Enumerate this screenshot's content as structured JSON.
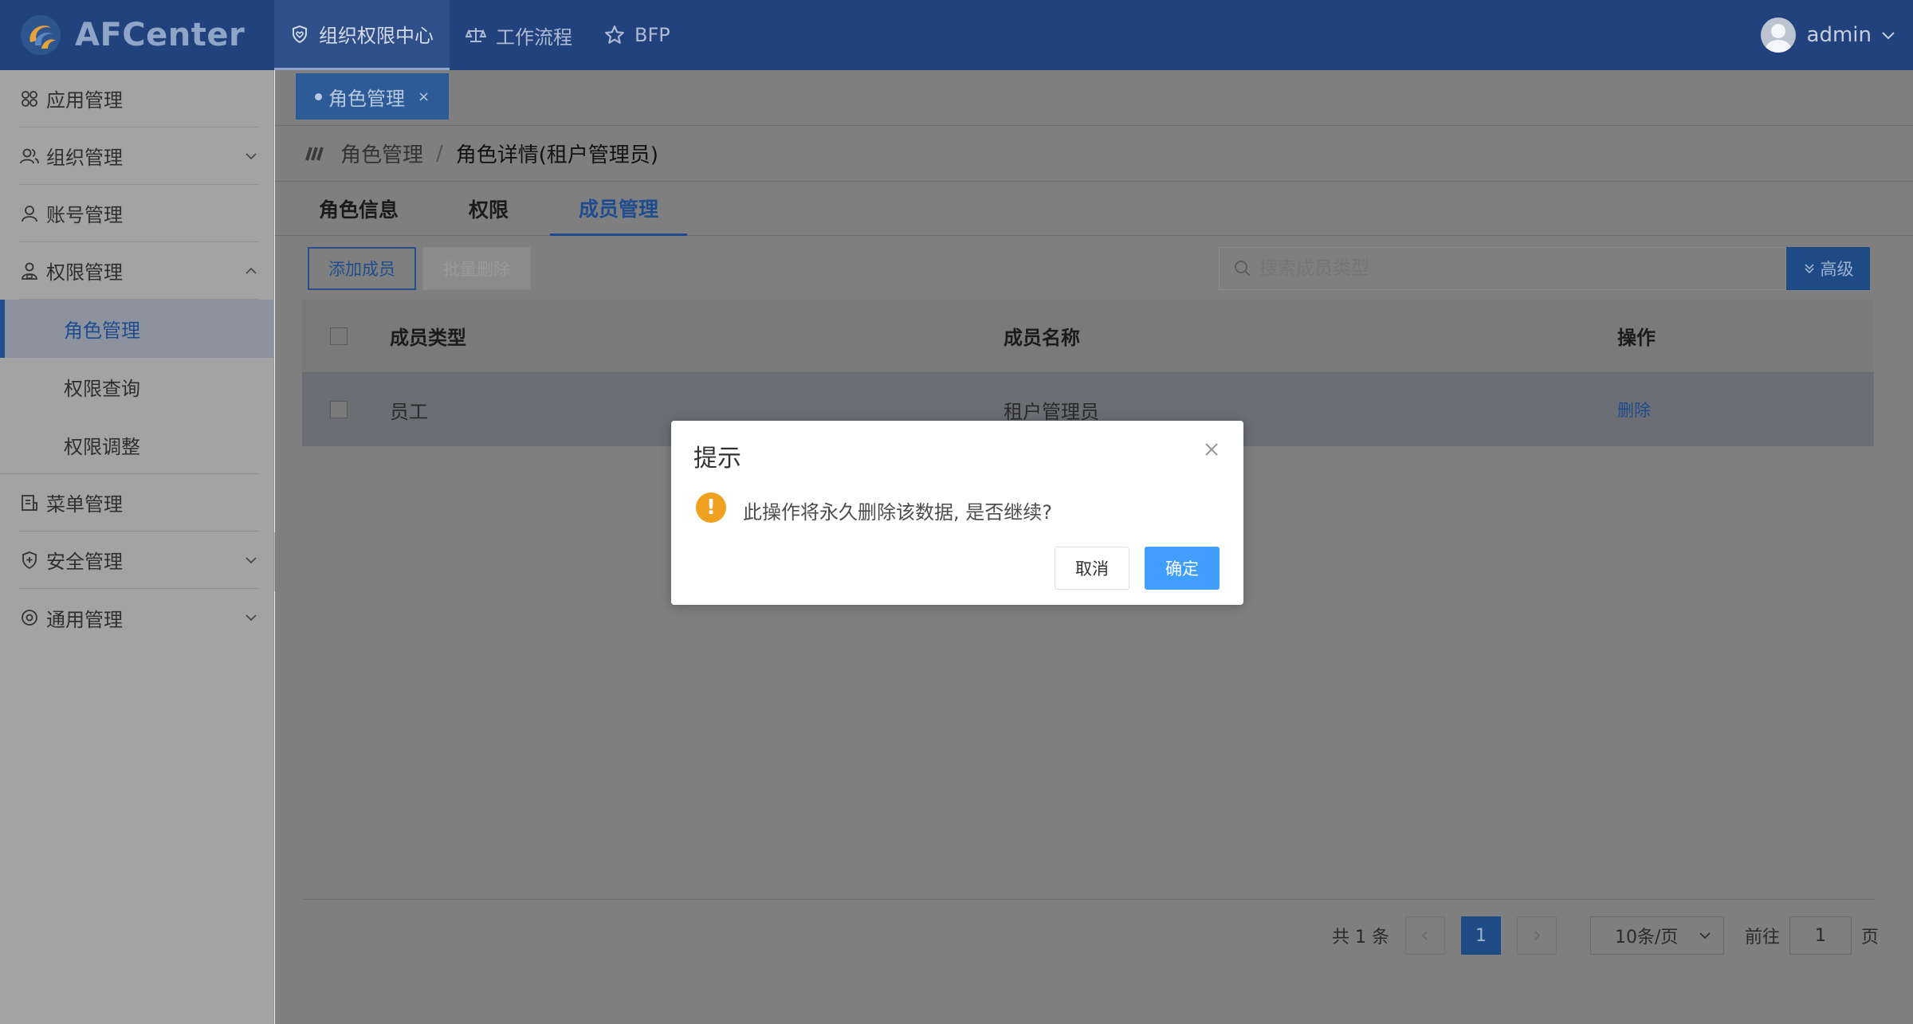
{
  "app": {
    "name": "AFCenter"
  },
  "topnav": {
    "items": [
      {
        "label": "组织权限中心",
        "icon": "shield-heart-icon",
        "active": true
      },
      {
        "label": "工作流程",
        "icon": "scale-icon",
        "active": false
      },
      {
        "label": "BFP",
        "icon": "star-icon",
        "active": false
      }
    ]
  },
  "user": {
    "name": "admin"
  },
  "sidebar": {
    "items": [
      {
        "label": "应用管理",
        "icon": "grid-icon"
      },
      {
        "label": "组织管理",
        "icon": "users-icon",
        "expandable": true
      },
      {
        "label": "账号管理",
        "icon": "user-icon"
      },
      {
        "label": "权限管理",
        "icon": "user-lock-icon",
        "expanded": true
      },
      {
        "label": "菜单管理",
        "icon": "menu-doc-icon"
      },
      {
        "label": "安全管理",
        "icon": "shield-plus-icon",
        "expandable": true
      },
      {
        "label": "通用管理",
        "icon": "settings-icon",
        "expandable": true
      }
    ],
    "sub_items": [
      {
        "label": "角色管理",
        "active": true
      },
      {
        "label": "权限查询",
        "active": false
      },
      {
        "label": "权限调整",
        "active": false
      }
    ]
  },
  "page_tab": {
    "label": "角色管理",
    "close": "×"
  },
  "breadcrumb": {
    "root": "角色管理",
    "separator": "/",
    "current": "角色详情(租户管理员)"
  },
  "tabs": [
    {
      "label": "角色信息",
      "active": false
    },
    {
      "label": "权限",
      "active": false
    },
    {
      "label": "成员管理",
      "active": true
    }
  ],
  "toolbar": {
    "add_label": "添加成员",
    "batch_delete_label": "批量删除",
    "search_placeholder": "搜索成员类型",
    "advanced_label": "高级"
  },
  "table": {
    "headers": [
      "成员类型",
      "成员名称",
      "操作"
    ],
    "rows": [
      {
        "type": "员工",
        "name": "租户管理员",
        "action": "删除"
      }
    ]
  },
  "pagination": {
    "total_text": "共 1 条",
    "current_page": "1",
    "page_size": "10条/页",
    "goto_label": "前往",
    "goto_value": "1",
    "page_suffix": "页"
  },
  "dialog": {
    "title": "提示",
    "message": "此操作将永久删除该数据, 是否继续?",
    "cancel_label": "取消",
    "confirm_label": "确定"
  },
  "colors": {
    "topbar": "#22427e",
    "accent": "#409eff",
    "warning": "#f0a11f"
  }
}
